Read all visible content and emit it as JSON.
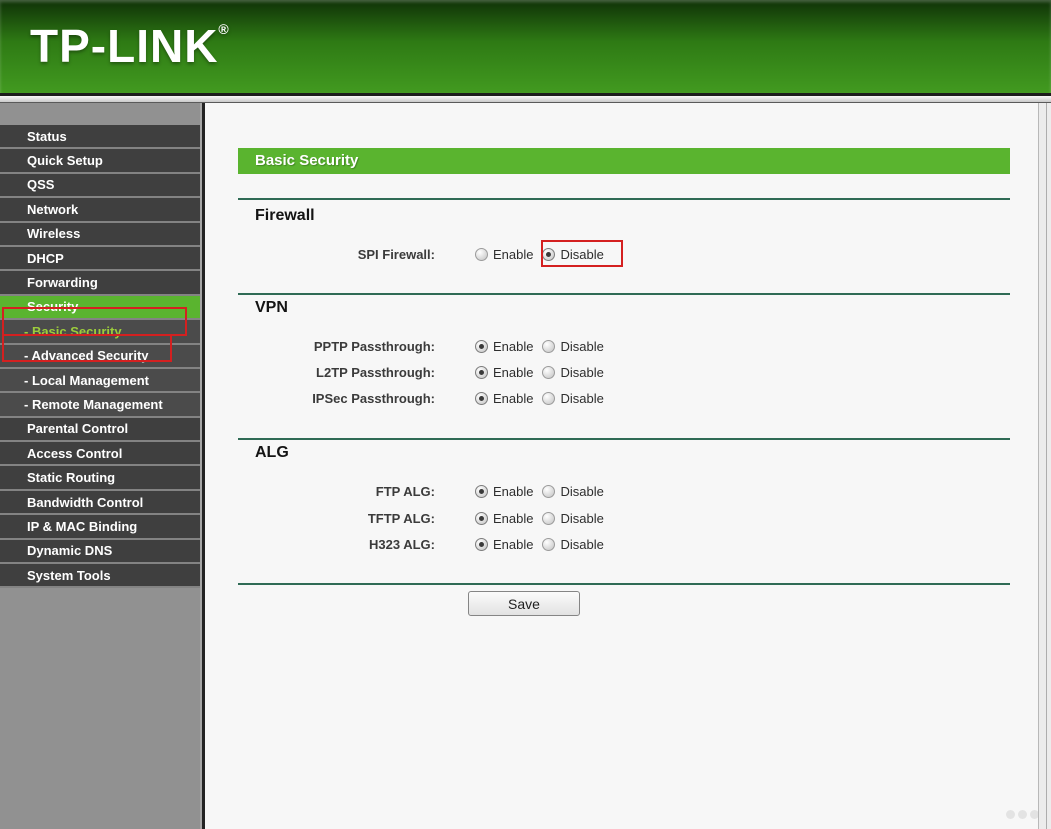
{
  "header": {
    "logo": "TP-LINK",
    "registered": "®"
  },
  "sidebar": {
    "items": [
      {
        "label": "Status"
      },
      {
        "label": "Quick Setup"
      },
      {
        "label": "QSS"
      },
      {
        "label": "Network"
      },
      {
        "label": "Wireless"
      },
      {
        "label": "DHCP"
      },
      {
        "label": "Forwarding"
      },
      {
        "label": "Security",
        "selected": true,
        "annotated": true
      },
      {
        "label": "- Basic Security",
        "active_sub": true,
        "annotated": true
      },
      {
        "label": "- Advanced Security"
      },
      {
        "label": "- Local Management"
      },
      {
        "label": "- Remote Management"
      },
      {
        "label": "Parental Control"
      },
      {
        "label": "Access Control"
      },
      {
        "label": "Static Routing"
      },
      {
        "label": "Bandwidth Control"
      },
      {
        "label": "IP & MAC Binding"
      },
      {
        "label": "Dynamic DNS"
      },
      {
        "label": "System Tools"
      }
    ]
  },
  "main": {
    "title": "Basic Security",
    "radio_options": [
      "Enable",
      "Disable"
    ],
    "sections": [
      {
        "heading": "Firewall",
        "rows": [
          {
            "label": "SPI Firewall:",
            "selected": "Disable",
            "annotated": true
          }
        ]
      },
      {
        "heading": "VPN",
        "rows": [
          {
            "label": "PPTP Passthrough:",
            "selected": "Enable"
          },
          {
            "label": "L2TP Passthrough:",
            "selected": "Enable"
          },
          {
            "label": "IPSec Passthrough:",
            "selected": "Enable"
          }
        ]
      },
      {
        "heading": "ALG",
        "rows": [
          {
            "label": "FTP ALG:",
            "selected": "Enable"
          },
          {
            "label": "TFTP ALG:",
            "selected": "Enable"
          },
          {
            "label": "H323 ALG:",
            "selected": "Enable"
          }
        ]
      }
    ],
    "save_label": "Save"
  },
  "colors": {
    "accent_green": "#5ab42f",
    "header_green_dark": "#0f3107",
    "header_green_light": "#429a20",
    "separator_green": "#2f6b55",
    "annotation_red": "#d42020",
    "sidebar_item_bg": "#3f3f3f",
    "sidebar_sub_bg": "#4b4b4b",
    "sidebar_bg": "#919191",
    "submenu_active_text": "#9ccd3c"
  }
}
